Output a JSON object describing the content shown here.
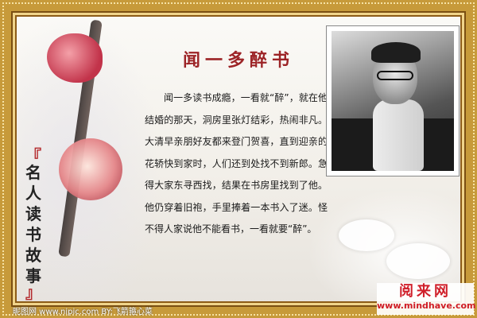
{
  "title": "闻一多醉书",
  "banner": {
    "open": "『",
    "chars": [
      "名",
      "人",
      "读",
      "书",
      "故",
      "事"
    ],
    "close": "』"
  },
  "body": "闻一多读书成瘾，一看就“醉”，就在他结婚的那天，洞房里张灯结彩，热闹非凡。大清早亲朋好友都来登门贺喜，直到迎亲的花轿快到家时，人们还到处找不到新郎。急得大家东寻西找，结果在书房里找到了他。他仍穿着旧袍，手里捧着一本书入了迷。怪不得人家说他不能看书，一看就要“醉”。",
  "watermark": {
    "left": "昵图网 www.nipic.com  BY:飞箭箍心菜",
    "site_name": "阅来网",
    "site_url": "www.mindhave.com"
  }
}
